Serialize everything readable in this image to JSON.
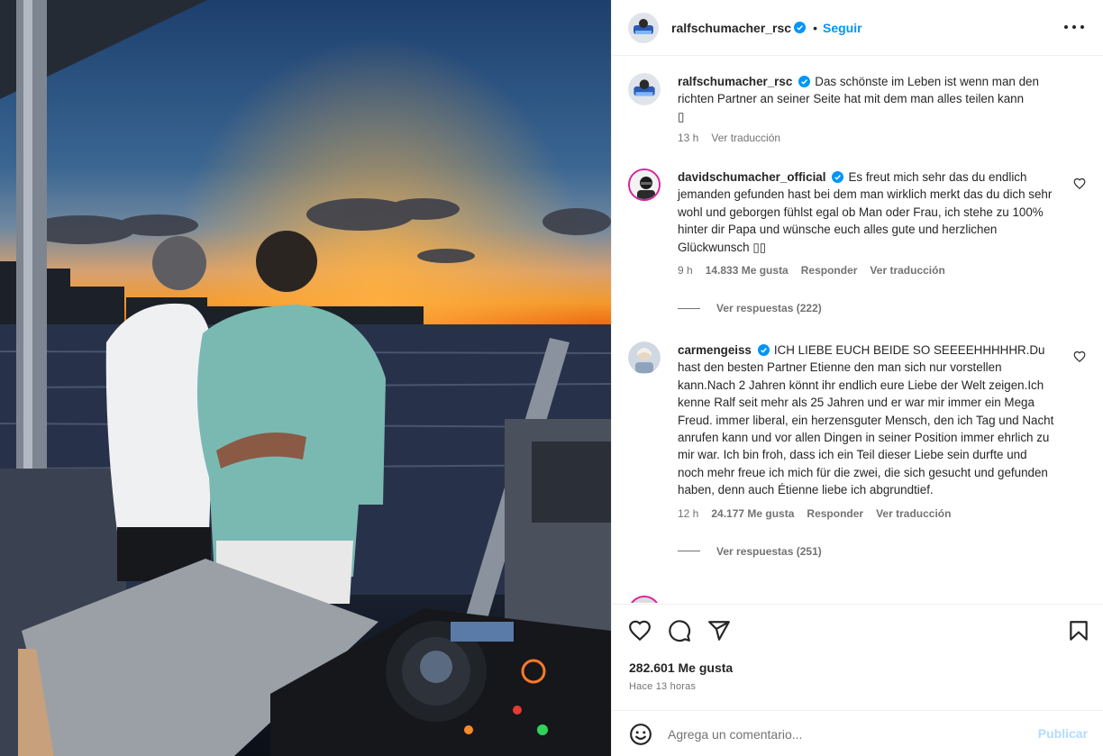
{
  "post": {
    "author": "ralfschumacher_rsc",
    "follow_label": "Seguir",
    "separator": "•"
  },
  "comments": [
    {
      "user": "ralfschumacher_rsc",
      "text": "Das schönste im Leben ist wenn man den richten Partner an seiner Seite hat mit dem man alles teilen kann",
      "emoji": "▯",
      "time": "13 h",
      "translate": "Ver traducción"
    },
    {
      "user": "davidschumacher_official",
      "text": "Es freut mich sehr das du endlich jemanden gefunden hast bei dem man wirklich merkt das du dich sehr wohl und geborgen fühlst egal ob Man oder Frau, ich stehe zu 100% hinter dir Papa und wünsche euch alles gute und herzlichen Glückwunsch ▯▯",
      "time": "9 h",
      "likes": "14.833 Me gusta",
      "reply": "Responder",
      "translate": "Ver traducción",
      "replies": "Ver respuestas (222)"
    },
    {
      "user": "carmengeiss",
      "text": "ICH LIEBE EUCH BEIDE SO SEEEEHHHHHR.Du hast den besten Partner Etienne den man sich nur vorstellen kann.Nach 2 Jahren könnt ihr endlich eure Liebe der Welt zeigen.Ich kenne Ralf seit mehr als 25 Jahren und er war mir immer ein Mega Freud. immer liberal, ein herzensguter Mensch, den ich Tag und Nacht anrufen kann und vor allen Dingen in seiner Position immer ehrlich zu mir war. Ich bin froh, dass ich ein Teil dieser Liebe sein durfte und noch mehr freue ich mich für die zwei, die sich gesucht und gefunden haben, denn auch Étienne liebe ich abgrundtief.",
      "time": "12 h",
      "likes": "24.177 Me gusta",
      "reply": "Responder",
      "translate": "Ver traducción",
      "replies": "Ver respuestas (251)"
    }
  ],
  "stats": {
    "likes": "282.601 Me gusta",
    "posted_ago": "Hace 13 horas"
  },
  "add_comment": {
    "placeholder": "Agrega un comentario...",
    "publish_label": "Publicar"
  },
  "icons": {
    "like": "heart-icon",
    "comment": "comment-bubble-icon",
    "share": "paper-plane-icon",
    "save": "bookmark-icon",
    "more": "more-options-icon",
    "emoji": "emoji-icon",
    "verified": "verified-badge-icon"
  },
  "colors": {
    "link_blue": "#0095f6",
    "verified_blue": "#0095f6",
    "secondary_text": "#737373",
    "publish_disabled": "#b3dbff",
    "border": "#efefef"
  }
}
